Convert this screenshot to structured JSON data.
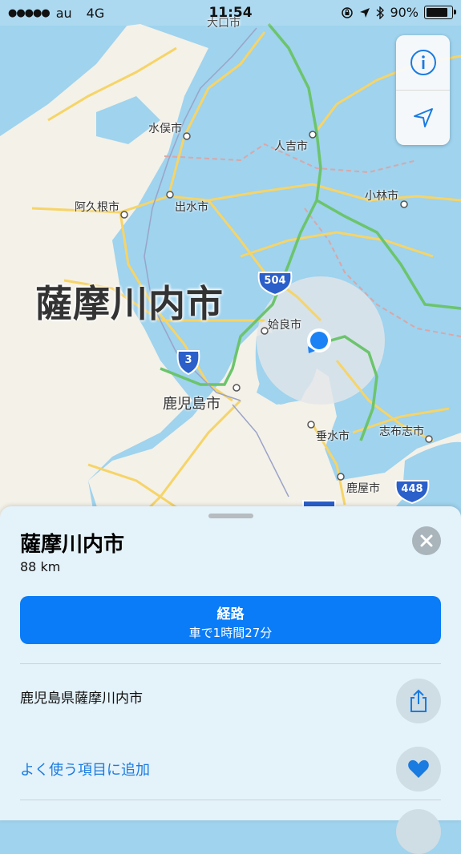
{
  "status_bar": {
    "carrier": "au",
    "network": "4G",
    "time": "11:54",
    "battery": "90%"
  },
  "map": {
    "region_label": "薩摩川内市",
    "cities": [
      "大口市",
      "水俣市",
      "人吉市",
      "阿久根市",
      "出水市",
      "小林市",
      "姶良市",
      "鹿児島市",
      "垂水市",
      "志布志市",
      "鹿屋市"
    ],
    "route_shields": [
      "504",
      "3",
      "448"
    ],
    "colors": {
      "sea": "#9fd3ee",
      "land": "#f4f1e8",
      "road": "#f6d467",
      "expressway": "#6cc46c"
    }
  },
  "place_card": {
    "title": "薩摩川内市",
    "distance": "88 km",
    "route_button": {
      "label": "経路",
      "detail": "車で1時間27分"
    },
    "address": "鹿児島県薩摩川内市",
    "favorite_label": "よく使う項目に追加",
    "accent_color": "#0a7cf7"
  },
  "icons": [
    "info-icon",
    "location-arrow-icon",
    "close-icon",
    "share-icon",
    "heart-icon"
  ]
}
